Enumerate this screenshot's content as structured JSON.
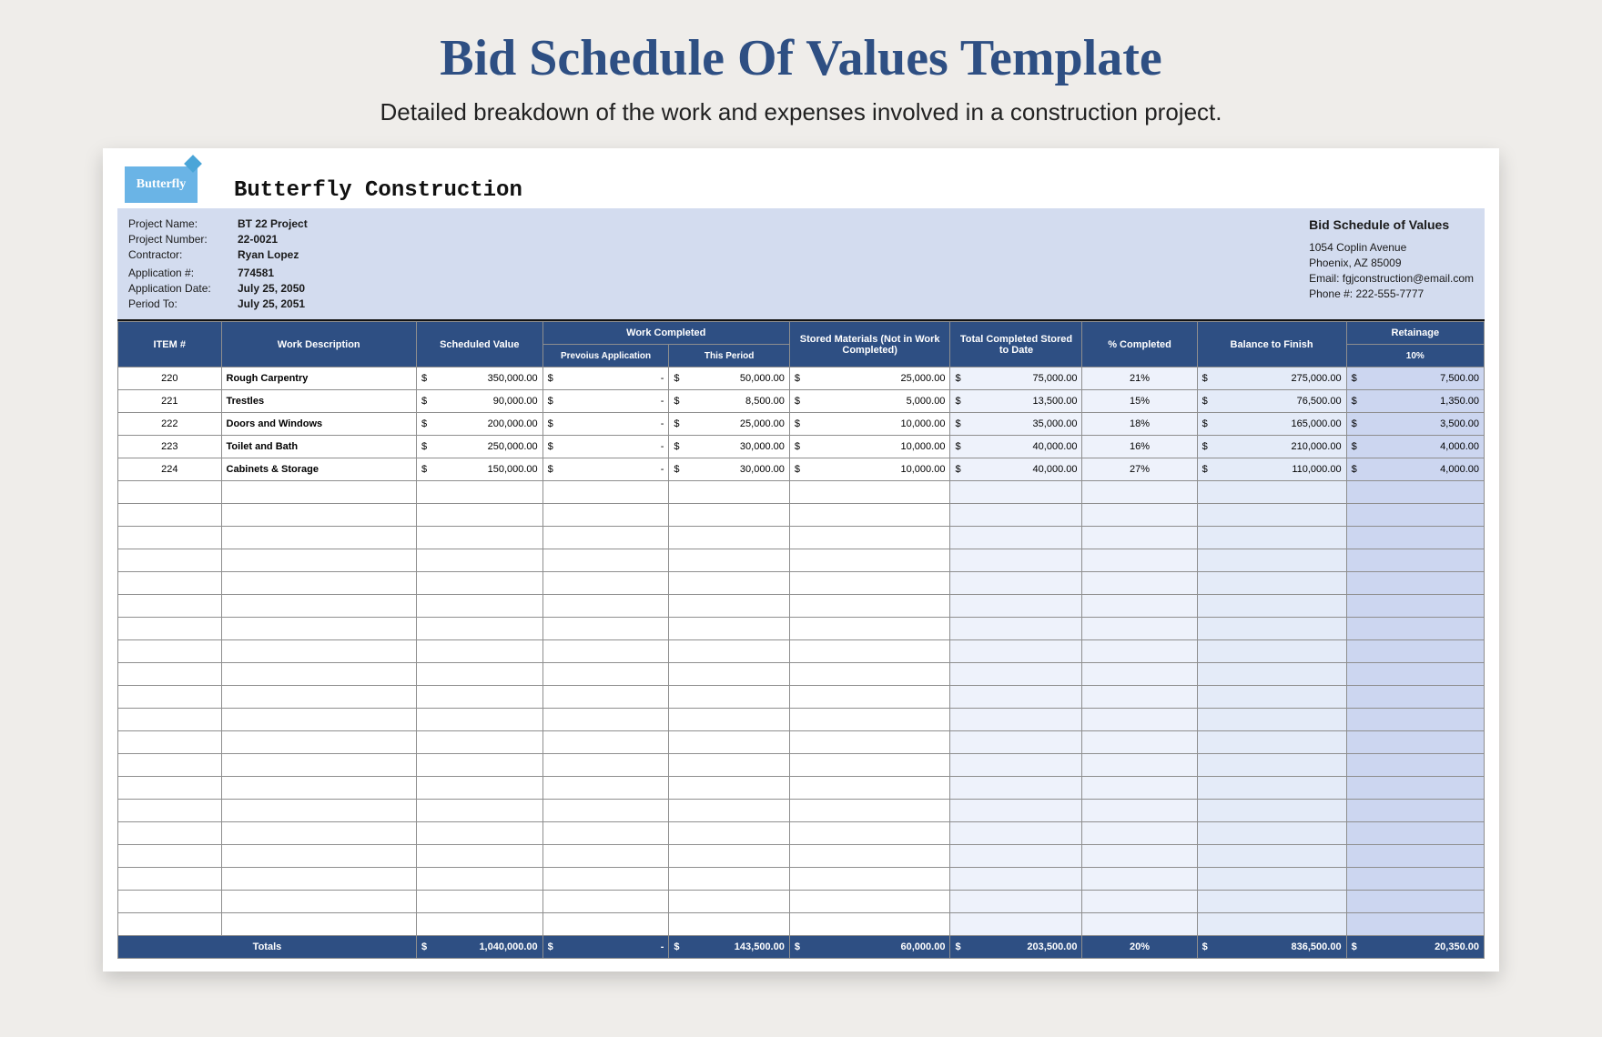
{
  "page": {
    "title": "Bid Schedule Of Values Template",
    "subtitle": "Detailed breakdown of the work and expenses involved in a construction project."
  },
  "logo_text": "Butterfly",
  "company_name": "Butterfly Construction",
  "meta": {
    "labels": {
      "project_name": "Project Name:",
      "project_number": "Project Number:",
      "contractor": "Contractor:",
      "application_no": "Application #:",
      "application_date": "Application Date:",
      "period_to": "Period To:"
    },
    "values": {
      "project_name": "BT 22 Project",
      "project_number": "22-0021",
      "contractor": "Ryan Lopez",
      "application_no": "774581",
      "application_date": "July 25, 2050",
      "period_to": "July 25, 2051"
    }
  },
  "doc_title": "Bid Schedule of Values",
  "address": {
    "line1": "1054 Coplin Avenue",
    "line2": "Phoenix, AZ 85009",
    "email": "Email: fgjconstruction@email.com",
    "phone": "Phone #: 222-555-7777"
  },
  "headers": {
    "item": "ITEM #",
    "desc": "Work Description",
    "scheduled": "Scheduled Value",
    "work_completed": "Work Completed",
    "prev": "Prevoius Application",
    "period": "This Period",
    "stored": "Stored Materials (Not in Work Completed)",
    "total_completed": "Total Completed Stored to Date",
    "pct": "% Completed",
    "balance": "Balance to Finish",
    "retainage": "Retainage",
    "ret_pct": "10%"
  },
  "currency": "$",
  "rows": [
    {
      "item": "220",
      "desc": "Rough Carpentry",
      "sv": "350,000.00",
      "prev": "-",
      "per": "50,000.00",
      "sm": "25,000.00",
      "tc": "75,000.00",
      "pct": "21%",
      "bal": "275,000.00",
      "ret": "7,500.00"
    },
    {
      "item": "221",
      "desc": "Trestles",
      "sv": "90,000.00",
      "prev": "-",
      "per": "8,500.00",
      "sm": "5,000.00",
      "tc": "13,500.00",
      "pct": "15%",
      "bal": "76,500.00",
      "ret": "1,350.00"
    },
    {
      "item": "222",
      "desc": "Doors and Windows",
      "sv": "200,000.00",
      "prev": "-",
      "per": "25,000.00",
      "sm": "10,000.00",
      "tc": "35,000.00",
      "pct": "18%",
      "bal": "165,000.00",
      "ret": "3,500.00"
    },
    {
      "item": "223",
      "desc": "Toilet and Bath",
      "sv": "250,000.00",
      "prev": "-",
      "per": "30,000.00",
      "sm": "10,000.00",
      "tc": "40,000.00",
      "pct": "16%",
      "bal": "210,000.00",
      "ret": "4,000.00"
    },
    {
      "item": "224",
      "desc": "Cabinets & Storage",
      "sv": "150,000.00",
      "prev": "-",
      "per": "30,000.00",
      "sm": "10,000.00",
      "tc": "40,000.00",
      "pct": "27%",
      "bal": "110,000.00",
      "ret": "4,000.00"
    }
  ],
  "empty_rows": 20,
  "totals": {
    "label": "Totals",
    "sv": "1,040,000.00",
    "prev": "-",
    "per": "143,500.00",
    "sm": "60,000.00",
    "tc": "203,500.00",
    "pct": "20%",
    "bal": "836,500.00",
    "ret": "20,350.00"
  }
}
